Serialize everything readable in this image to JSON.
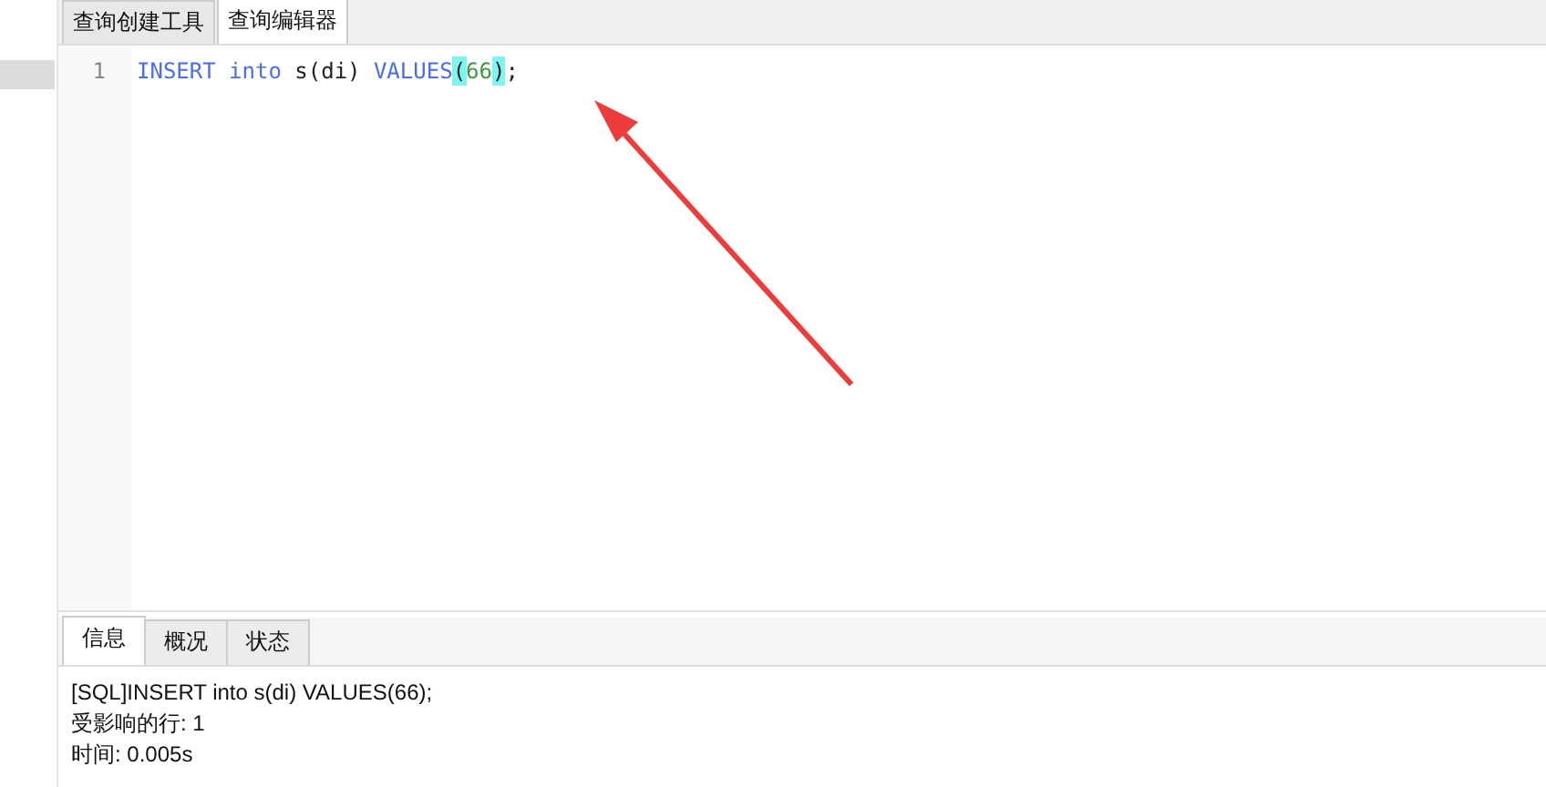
{
  "query_tabs": [
    {
      "label": "查询创建工具",
      "selected": false
    },
    {
      "label": "查询编辑器",
      "selected": true
    }
  ],
  "editor": {
    "lines": [
      {
        "number": "1",
        "tokens": [
          {
            "kind": "keyword",
            "text": "INSERT",
            "bracket_match": false
          },
          {
            "kind": "keyword",
            "text": "into",
            "bracket_match": false,
            "space_before": true
          },
          {
            "kind": "ident",
            "text": "s(di)",
            "bracket_match": false,
            "space_before": true
          },
          {
            "kind": "keyword",
            "text": "VALUES",
            "bracket_match": false,
            "space_before": true
          },
          {
            "kind": "punct",
            "text": "(",
            "bracket_match": true
          },
          {
            "kind": "number",
            "text": "66",
            "bracket_match": false
          },
          {
            "kind": "punct",
            "text": ")",
            "bracket_match": true
          },
          {
            "kind": "punct",
            "text": ";",
            "bracket_match": false
          }
        ]
      }
    ]
  },
  "result_tabs": [
    {
      "label": "信息",
      "selected": true
    },
    {
      "label": "概况",
      "selected": false
    },
    {
      "label": "状态",
      "selected": false
    }
  ],
  "messages": [
    "[SQL]INSERT into s(di) VALUES(66);",
    "受影响的行: 1",
    "时间: 0.005s"
  ]
}
